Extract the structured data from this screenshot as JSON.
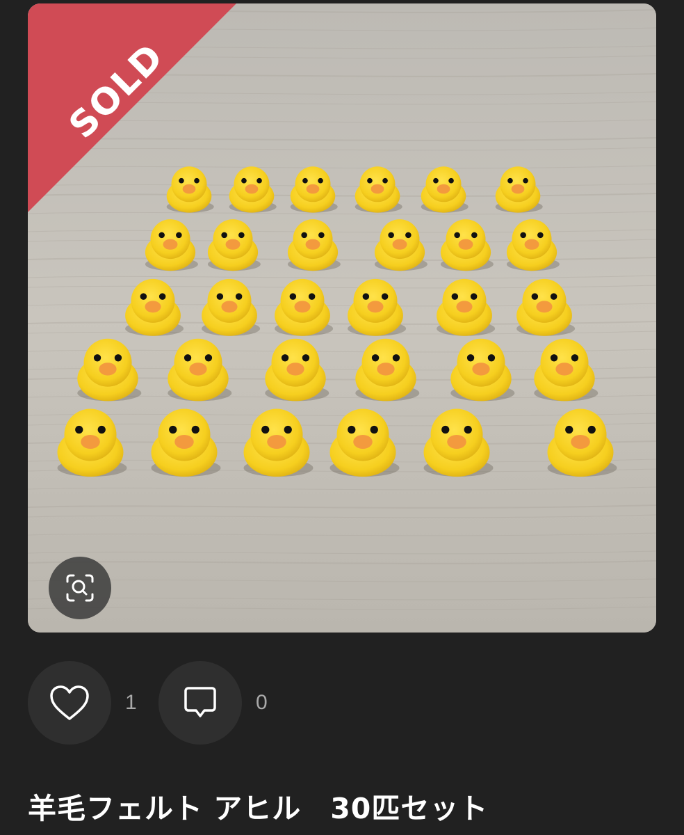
{
  "listing": {
    "status_badge": "SOLD",
    "title": "羊毛フェルト アヒル　30匹セット",
    "image_icon": "zoom-scan-icon"
  },
  "reactions": {
    "likes": {
      "icon": "heart-icon",
      "count": "1"
    },
    "comments": {
      "icon": "comment-icon",
      "count": "0"
    }
  },
  "colors": {
    "background": "#212121",
    "sold_ribbon": "#d04b55",
    "button_bg": "#2f2f2f",
    "count_text": "#a9a9a9",
    "title_text": "#ffffff"
  }
}
